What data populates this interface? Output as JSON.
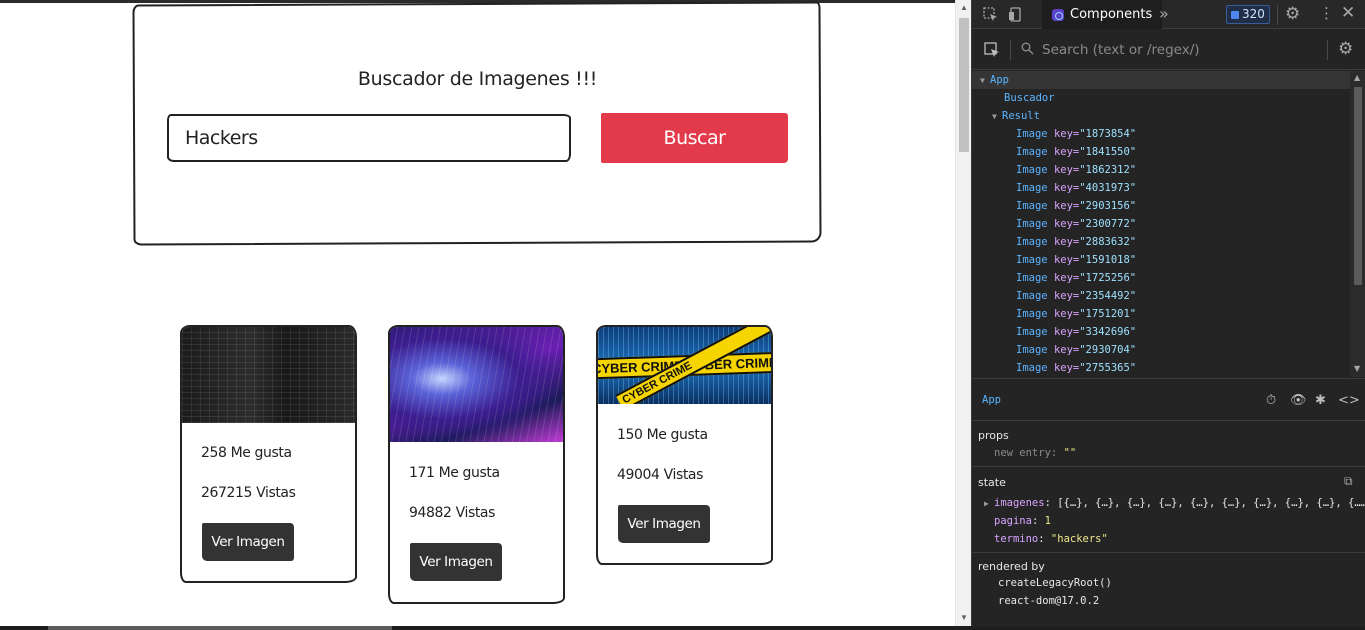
{
  "app": {
    "title": "Buscador de Imagenes !!!",
    "search": {
      "value": "Hackers",
      "button_label": "Buscar"
    },
    "cards": [
      {
        "likes": "258 Me gusta",
        "views": "267215 Vistas",
        "button_label": "Ver Imagen",
        "image": "hacker-code-screen"
      },
      {
        "likes": "171 Me gusta",
        "views": "94882 Vistas",
        "button_label": "Ver Imagen",
        "image": "purple-digital-tunnel"
      },
      {
        "likes": "150 Me gusta",
        "views": "49004 Vistas",
        "button_label": "Ver Imagen",
        "image": "cyber-crime-tape",
        "tape_text": "CYBER CRIME CYBER CRIME",
        "tape_text_2": "CYBER CRIME"
      }
    ]
  },
  "devtools": {
    "tab_label": "Components",
    "more_tabs": "»",
    "badge_count": "320",
    "search_placeholder": "Search (text or /regex/)",
    "tree": {
      "app": "App",
      "buscador": "Buscador",
      "result": "Result",
      "image_component": "Image",
      "key_attr": "key",
      "image_keys": [
        "\"1873854\"",
        "\"1841550\"",
        "\"1862312\"",
        "\"4031973\"",
        "\"2903156\"",
        "\"2300772\"",
        "\"2883632\"",
        "\"1591018\"",
        "\"1725256\"",
        "\"2354492\"",
        "\"1751201\"",
        "\"3342696\"",
        "\"2930704\"",
        "\"2755365\""
      ]
    },
    "selected": {
      "name": "App"
    },
    "props": {
      "title": "props",
      "new_entry_key": "new entry",
      "new_entry_value": "\"\""
    },
    "state": {
      "title": "state",
      "imagenes_key": "imagenes",
      "imagenes_value": "[{…}, {…}, {…}, {…}, {…}, {…}, {…}, {…}, {…}, {……",
      "pagina_key": "pagina",
      "pagina_value": "1",
      "termino_key": "termino",
      "termino_value": "\"hackers\""
    },
    "rendered_by": {
      "title": "rendered by",
      "lines": [
        "createLegacyRoot()",
        "react-dom@17.0.2"
      ]
    },
    "colors": {
      "panel_bg": "#242424",
      "component_name": "#5cb4ff",
      "attr_key": "#d9a4ff",
      "string_value": "#f0e68c"
    }
  },
  "colors": {
    "search_button": "#e33a4b",
    "card_button": "#333333"
  }
}
